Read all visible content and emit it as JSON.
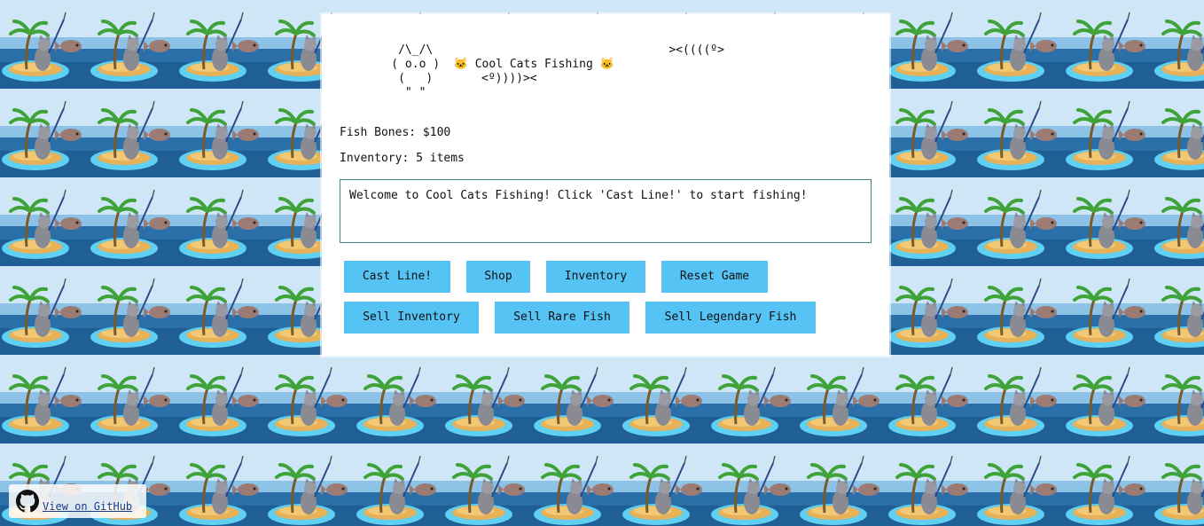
{
  "ascii_art": {
    "line1": "           /\\_/\\                                  ><((((º>",
    "line2": "          ( o.o )  🐱 Cool Cats Fishing 🐱",
    "line3": "           (   )       <º))))><",
    "line4": "            \" \""
  },
  "stats": {
    "fish_bones": "Fish Bones: $100",
    "inventory": "Inventory: 5 items"
  },
  "message_log": "Welcome to Cool Cats Fishing! Click 'Cast Line!' to start fishing!",
  "buttons": {
    "cast_line": "Cast Line!",
    "shop": "Shop",
    "inventory": "Inventory",
    "reset_game": "Reset Game",
    "sell_inventory": "Sell Inventory",
    "sell_rare_fish": "Sell Rare Fish",
    "sell_legendary_fish": "Sell Legendary Fish"
  },
  "footer": {
    "github_link": " View on GitHub"
  },
  "colors": {
    "button_bg": "#56c3f5",
    "log_border": "#3a8a86",
    "link": "#1a3a8c"
  },
  "background_icon": "cat-fishing-on-island-tile"
}
